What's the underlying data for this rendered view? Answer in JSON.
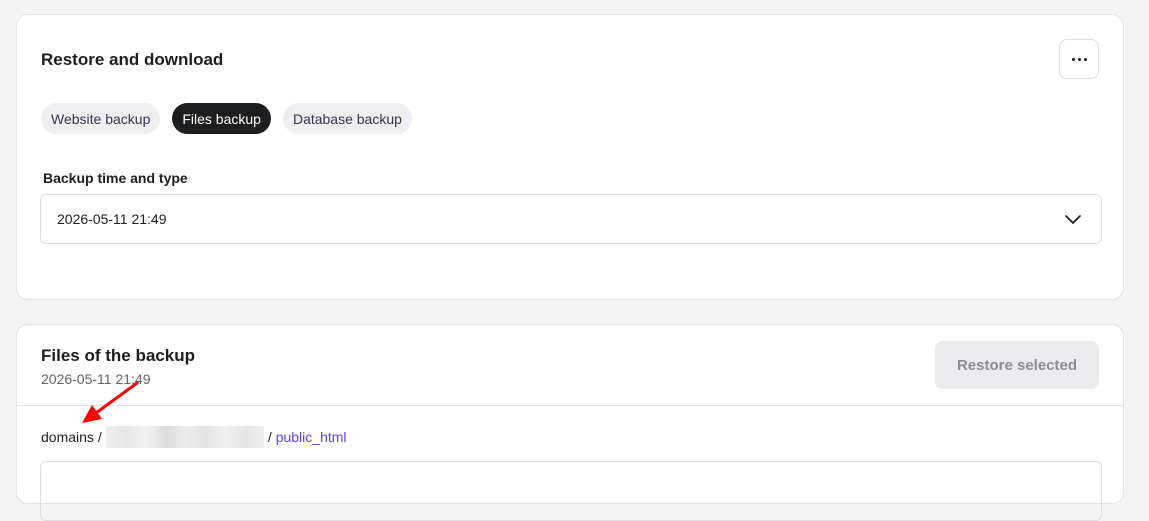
{
  "restore_card": {
    "title": "Restore and download",
    "more_icon": "more-horizontal-icon",
    "tabs": [
      {
        "label": "Website backup",
        "active": false
      },
      {
        "label": "Files backup",
        "active": true
      },
      {
        "label": "Database backup",
        "active": false
      }
    ],
    "field_label": "Backup time and type",
    "selected_value": "2026-05-11 21:49",
    "chevron_icon": "chevron-down-icon"
  },
  "files_card": {
    "title": "Files of the backup",
    "subtitle": "2026-05-11 21:49",
    "restore_button": "Restore selected",
    "breadcrumb": {
      "root": "domains",
      "separator": "/",
      "current": "public_html"
    }
  },
  "colors": {
    "accent": "#673de6",
    "active_chip": "#1d1e20",
    "annotation_arrow": "#ff0000"
  }
}
